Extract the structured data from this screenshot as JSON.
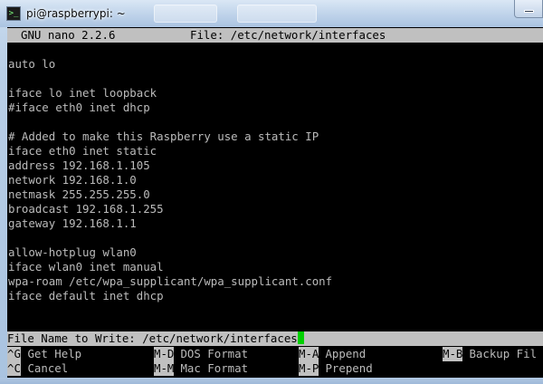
{
  "window": {
    "title": "pi@raspberrypi: ~"
  },
  "nano": {
    "version": "GNU nano 2.2.6",
    "file_label": "File: /etc/network/interfaces"
  },
  "file_lines": [
    "",
    "auto lo",
    "",
    "iface lo inet loopback",
    "#iface eth0 inet dhcp",
    "",
    "# Added to make this Raspberry use a static IP",
    "iface eth0 inet static",
    "address 192.168.1.105",
    "network 192.168.1.0",
    "netmask 255.255.255.0",
    "broadcast 192.168.1.255",
    "gateway 192.168.1.1",
    "",
    "allow-hotplug wlan0",
    "iface wlan0 inet manual",
    "wpa-roam /etc/wpa_supplicant/wpa_supplicant.conf",
    "iface default inet dhcp"
  ],
  "prompt": {
    "text": "File Name to Write: /etc/network/interfaces"
  },
  "shortcuts": {
    "row1": [
      {
        "key": "^G",
        "label": " Get Help"
      },
      {
        "key": "M-D",
        "label": " DOS Format"
      },
      {
        "key": "M-A",
        "label": " Append"
      },
      {
        "key": "M-B",
        "label": " Backup Fil"
      }
    ],
    "row2": [
      {
        "key": "^C",
        "label": " Cancel"
      },
      {
        "key": "M-M",
        "label": " Mac Format"
      },
      {
        "key": "M-P",
        "label": " Prepend"
      }
    ]
  },
  "colors": {
    "terminal_bg": "#000000",
    "terminal_fg": "#bbbbbb",
    "bar_bg": "#c0c0c0",
    "cursor": "#00d000"
  }
}
